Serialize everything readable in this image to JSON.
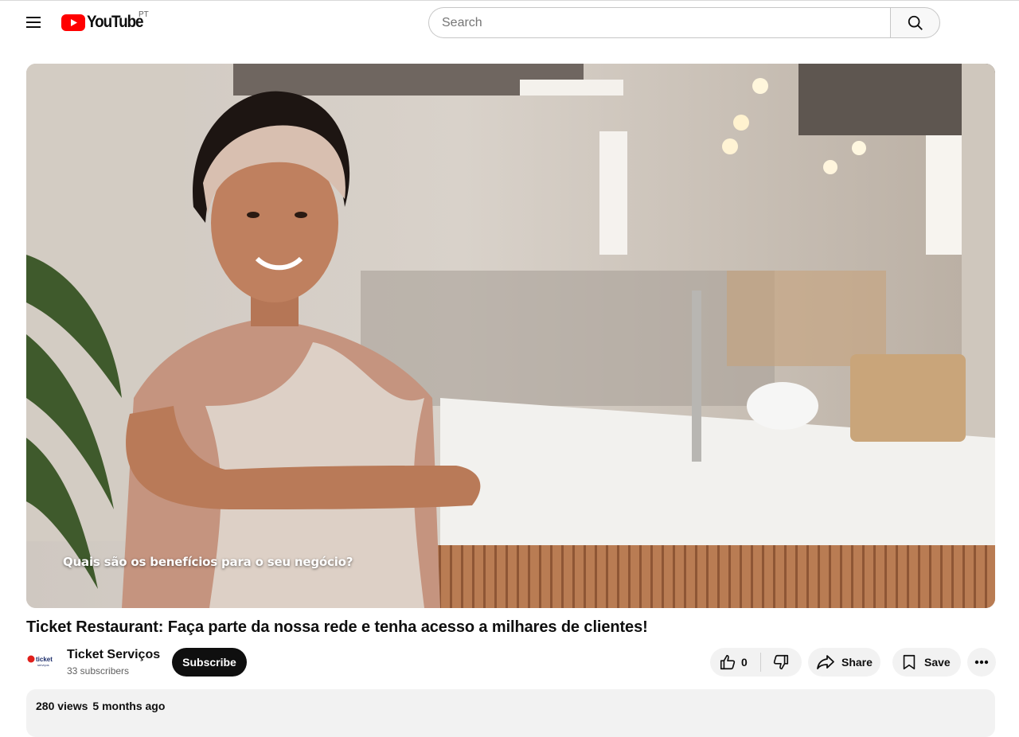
{
  "header": {
    "region": "PT",
    "search_placeholder": "Search",
    "logo_text": "YouTube"
  },
  "player": {
    "caption": "Quais são os benefícios para o seu negócio?"
  },
  "video": {
    "title": "Ticket Restaurant: Faça parte da nossa rede e tenha acesso a milhares de clientes!",
    "channel_name": "Ticket Serviços",
    "subscribers": "33 subscribers",
    "subscribe_label": "Subscribe",
    "like_count": "0",
    "share_label": "Share",
    "save_label": "Save",
    "views": "280 views",
    "published": "5 months ago",
    "avatar_text": "ticket"
  },
  "colors": {
    "brand_red": "#ff0000",
    "subscribe_bg": "#0f0f0f",
    "pill_bg": "#f2f2f2"
  },
  "icons": [
    "menu-icon",
    "youtube-logo-icon",
    "search-icon",
    "like-icon",
    "dislike-icon",
    "share-icon",
    "save-icon",
    "more-icon"
  ]
}
